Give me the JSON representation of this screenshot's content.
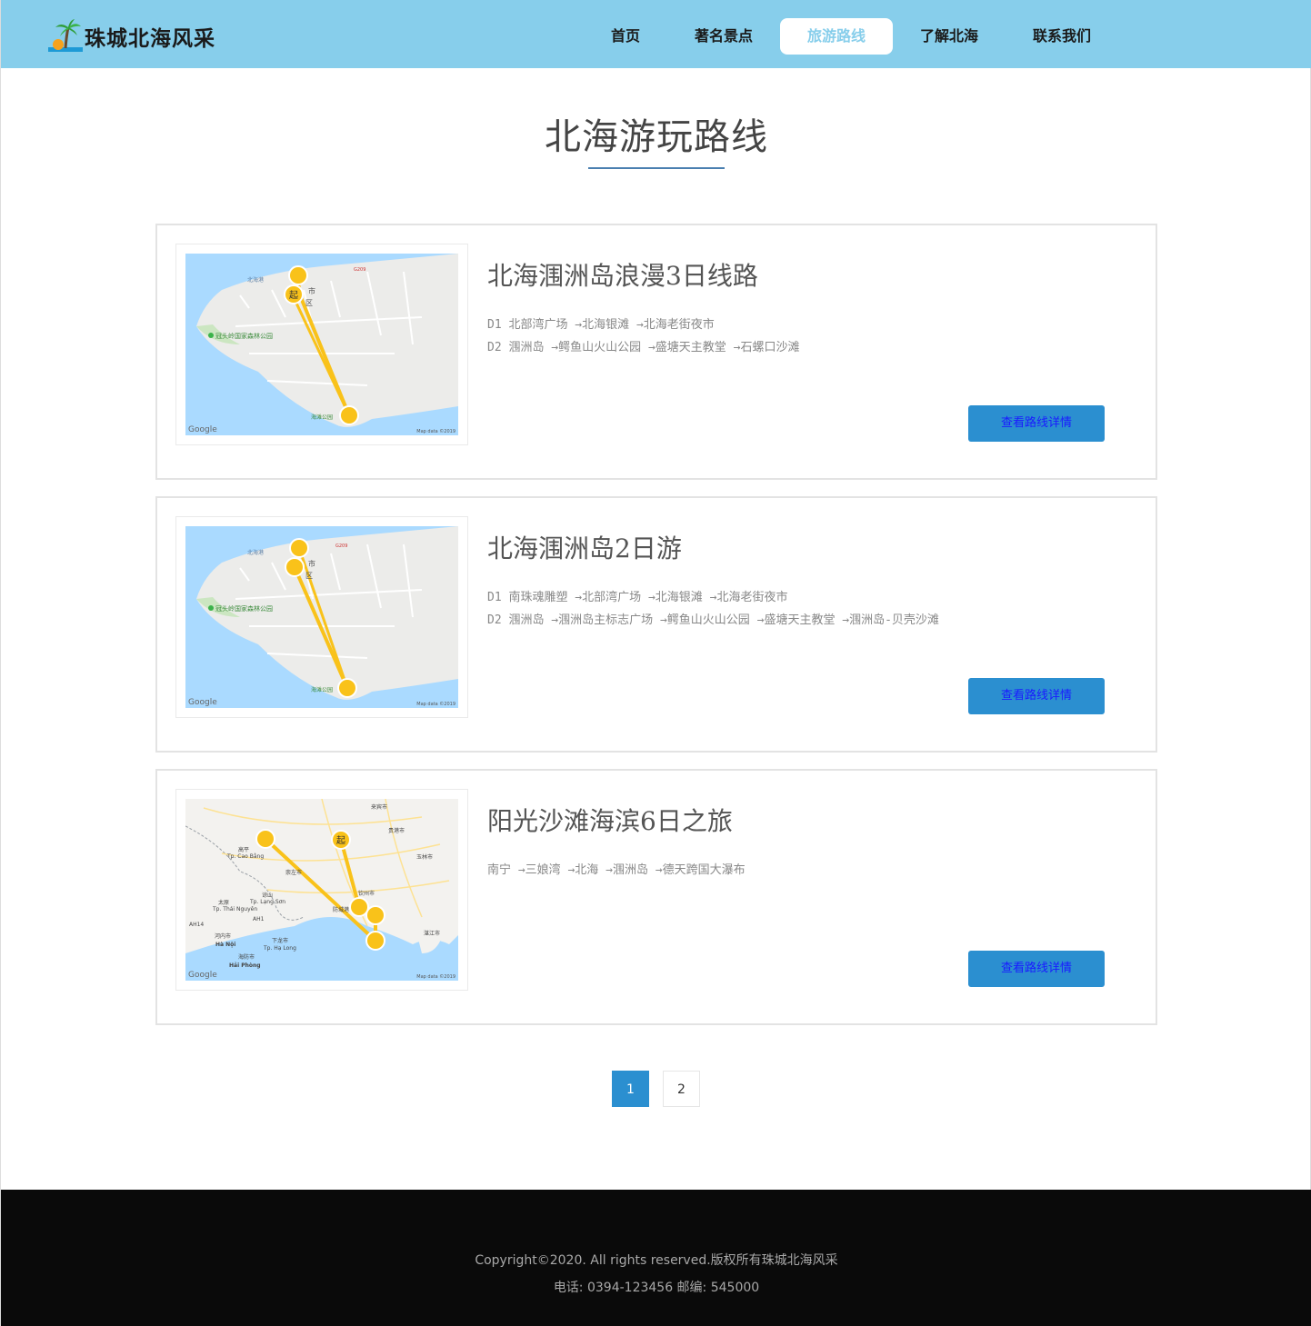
{
  "site": {
    "logo_text": "珠城北海风采"
  },
  "nav": {
    "items": [
      {
        "label": "首页"
      },
      {
        "label": "著名景点"
      },
      {
        "label": "旅游路线",
        "active": true
      },
      {
        "label": "了解北海"
      },
      {
        "label": "联系我们"
      }
    ]
  },
  "page": {
    "title": "北海游玩路线"
  },
  "routes": [
    {
      "title": "北海涠洲岛浪漫3日线路",
      "lines": [
        "D1 北部湾广场 →北海银滩 →北海老街夜市",
        "D2 涠洲岛 →鳄鱼山火山公园 →盛塘天主教堂 →石螺口沙滩"
      ],
      "button": "查看路线详情",
      "map": {
        "credit": "Map data ©2019",
        "brand": "Google",
        "start_mark": "起",
        "labels": [
          "北海港",
          "市",
          "区",
          "冠头岭国家森林公园",
          "海滩公园",
          "G209"
        ]
      }
    },
    {
      "title": "北海涠洲岛2日游",
      "lines": [
        "D1 南珠魂雕塑 →北部湾广场 →北海银滩 →北海老街夜市",
        "D2 涠洲岛 →涠洲岛主标志广场 →鳄鱼山火山公园 →盛塘天主教堂 →涠洲岛-贝壳沙滩"
      ],
      "button": "查看路线详情",
      "map": {
        "credit": "Map data ©2019",
        "brand": "Google",
        "labels": [
          "北海港",
          "市",
          "区",
          "冠头岭国家森林公园",
          "海滩公园",
          "G209"
        ]
      }
    },
    {
      "title": "阳光沙滩海滨6日之旅",
      "lines": [
        "南宁 →三娘湾 →北海 →涠洲岛 →德天跨国大瀑布"
      ],
      "button": "查看路线详情",
      "map": {
        "credit": "Map data ©2019",
        "brand": "Google",
        "start_mark": "起",
        "labels": [
          "来宾市",
          "贵港市",
          "玉林市",
          "高平",
          "Tp. Cao Bằng",
          "崇左市",
          "谅山",
          "Tp. Lạng Sơn",
          "太原",
          "Tp. Thái Nguyên",
          "钦州市",
          "防城港",
          "湛江市",
          "河内市",
          "Hà Nội",
          "下龙市",
          "Tp. Hạ Long",
          "海防市",
          "Hải Phòng",
          "AH14",
          "AH1"
        ]
      }
    }
  ],
  "pagination": {
    "pages": [
      "1",
      "2"
    ],
    "current": "1"
  },
  "footer": {
    "copyright": "Copyright©2020. All rights reserved.版权所有珠城北海风采",
    "contact": "电话: 0394-123456 邮编: 545000"
  },
  "colors": {
    "header_bg": "#87ceeb",
    "accent_blue": "#2b8fd0",
    "title_underline": "#4a7fb0",
    "footer_bg": "#0a0a0a"
  }
}
